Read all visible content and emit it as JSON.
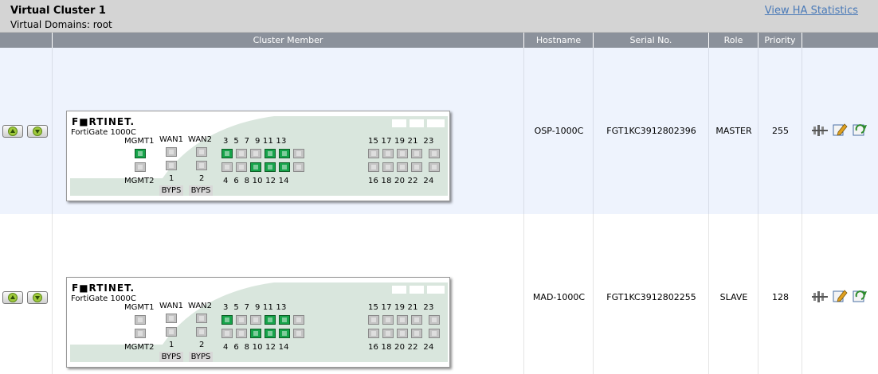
{
  "cluster": {
    "title": "Virtual Cluster 1",
    "domains": "Virtual Domains: root",
    "view_link": "View HA Statistics"
  },
  "columns": {
    "member": "Cluster Member",
    "hostname": "Hostname",
    "serial": "Serial No.",
    "role": "Role",
    "priority": "Priority"
  },
  "device": {
    "brand": "F■RTINET.",
    "model": "FortiGate 1000C",
    "labels": {
      "mgmt1": "MGMT1",
      "mgmt2": "MGMT2",
      "wan1": "WAN1",
      "wan2": "WAN2",
      "one": "1",
      "two": "2",
      "byps": "BYPS",
      "top_a": "3  5  7  9 11 13",
      "bot_a": "4  6  8 10 12 14",
      "top_b": "15 17 19 21  23",
      "bot_b": "16 18 20 22  24"
    }
  },
  "members": [
    {
      "hostname": "OSP-1000C",
      "serial": "FGT1KC3912802396",
      "role": "MASTER",
      "priority": "255",
      "active_ports": [
        "mgmt1",
        "p3",
        "p9",
        "p11",
        "p8",
        "p10",
        "p12"
      ]
    },
    {
      "hostname": "MAD-1000C",
      "serial": "FGT1KC3912802255",
      "role": "SLAVE",
      "priority": "128",
      "active_ports": [
        "p3",
        "p9",
        "p11",
        "p8",
        "p10",
        "p12"
      ]
    }
  ],
  "icons": {
    "move_up": "arrow-up-icon",
    "move_down": "arrow-down-icon",
    "disconnect": "disconnect-icon",
    "edit": "edit-icon",
    "refresh": "refresh-icon"
  }
}
